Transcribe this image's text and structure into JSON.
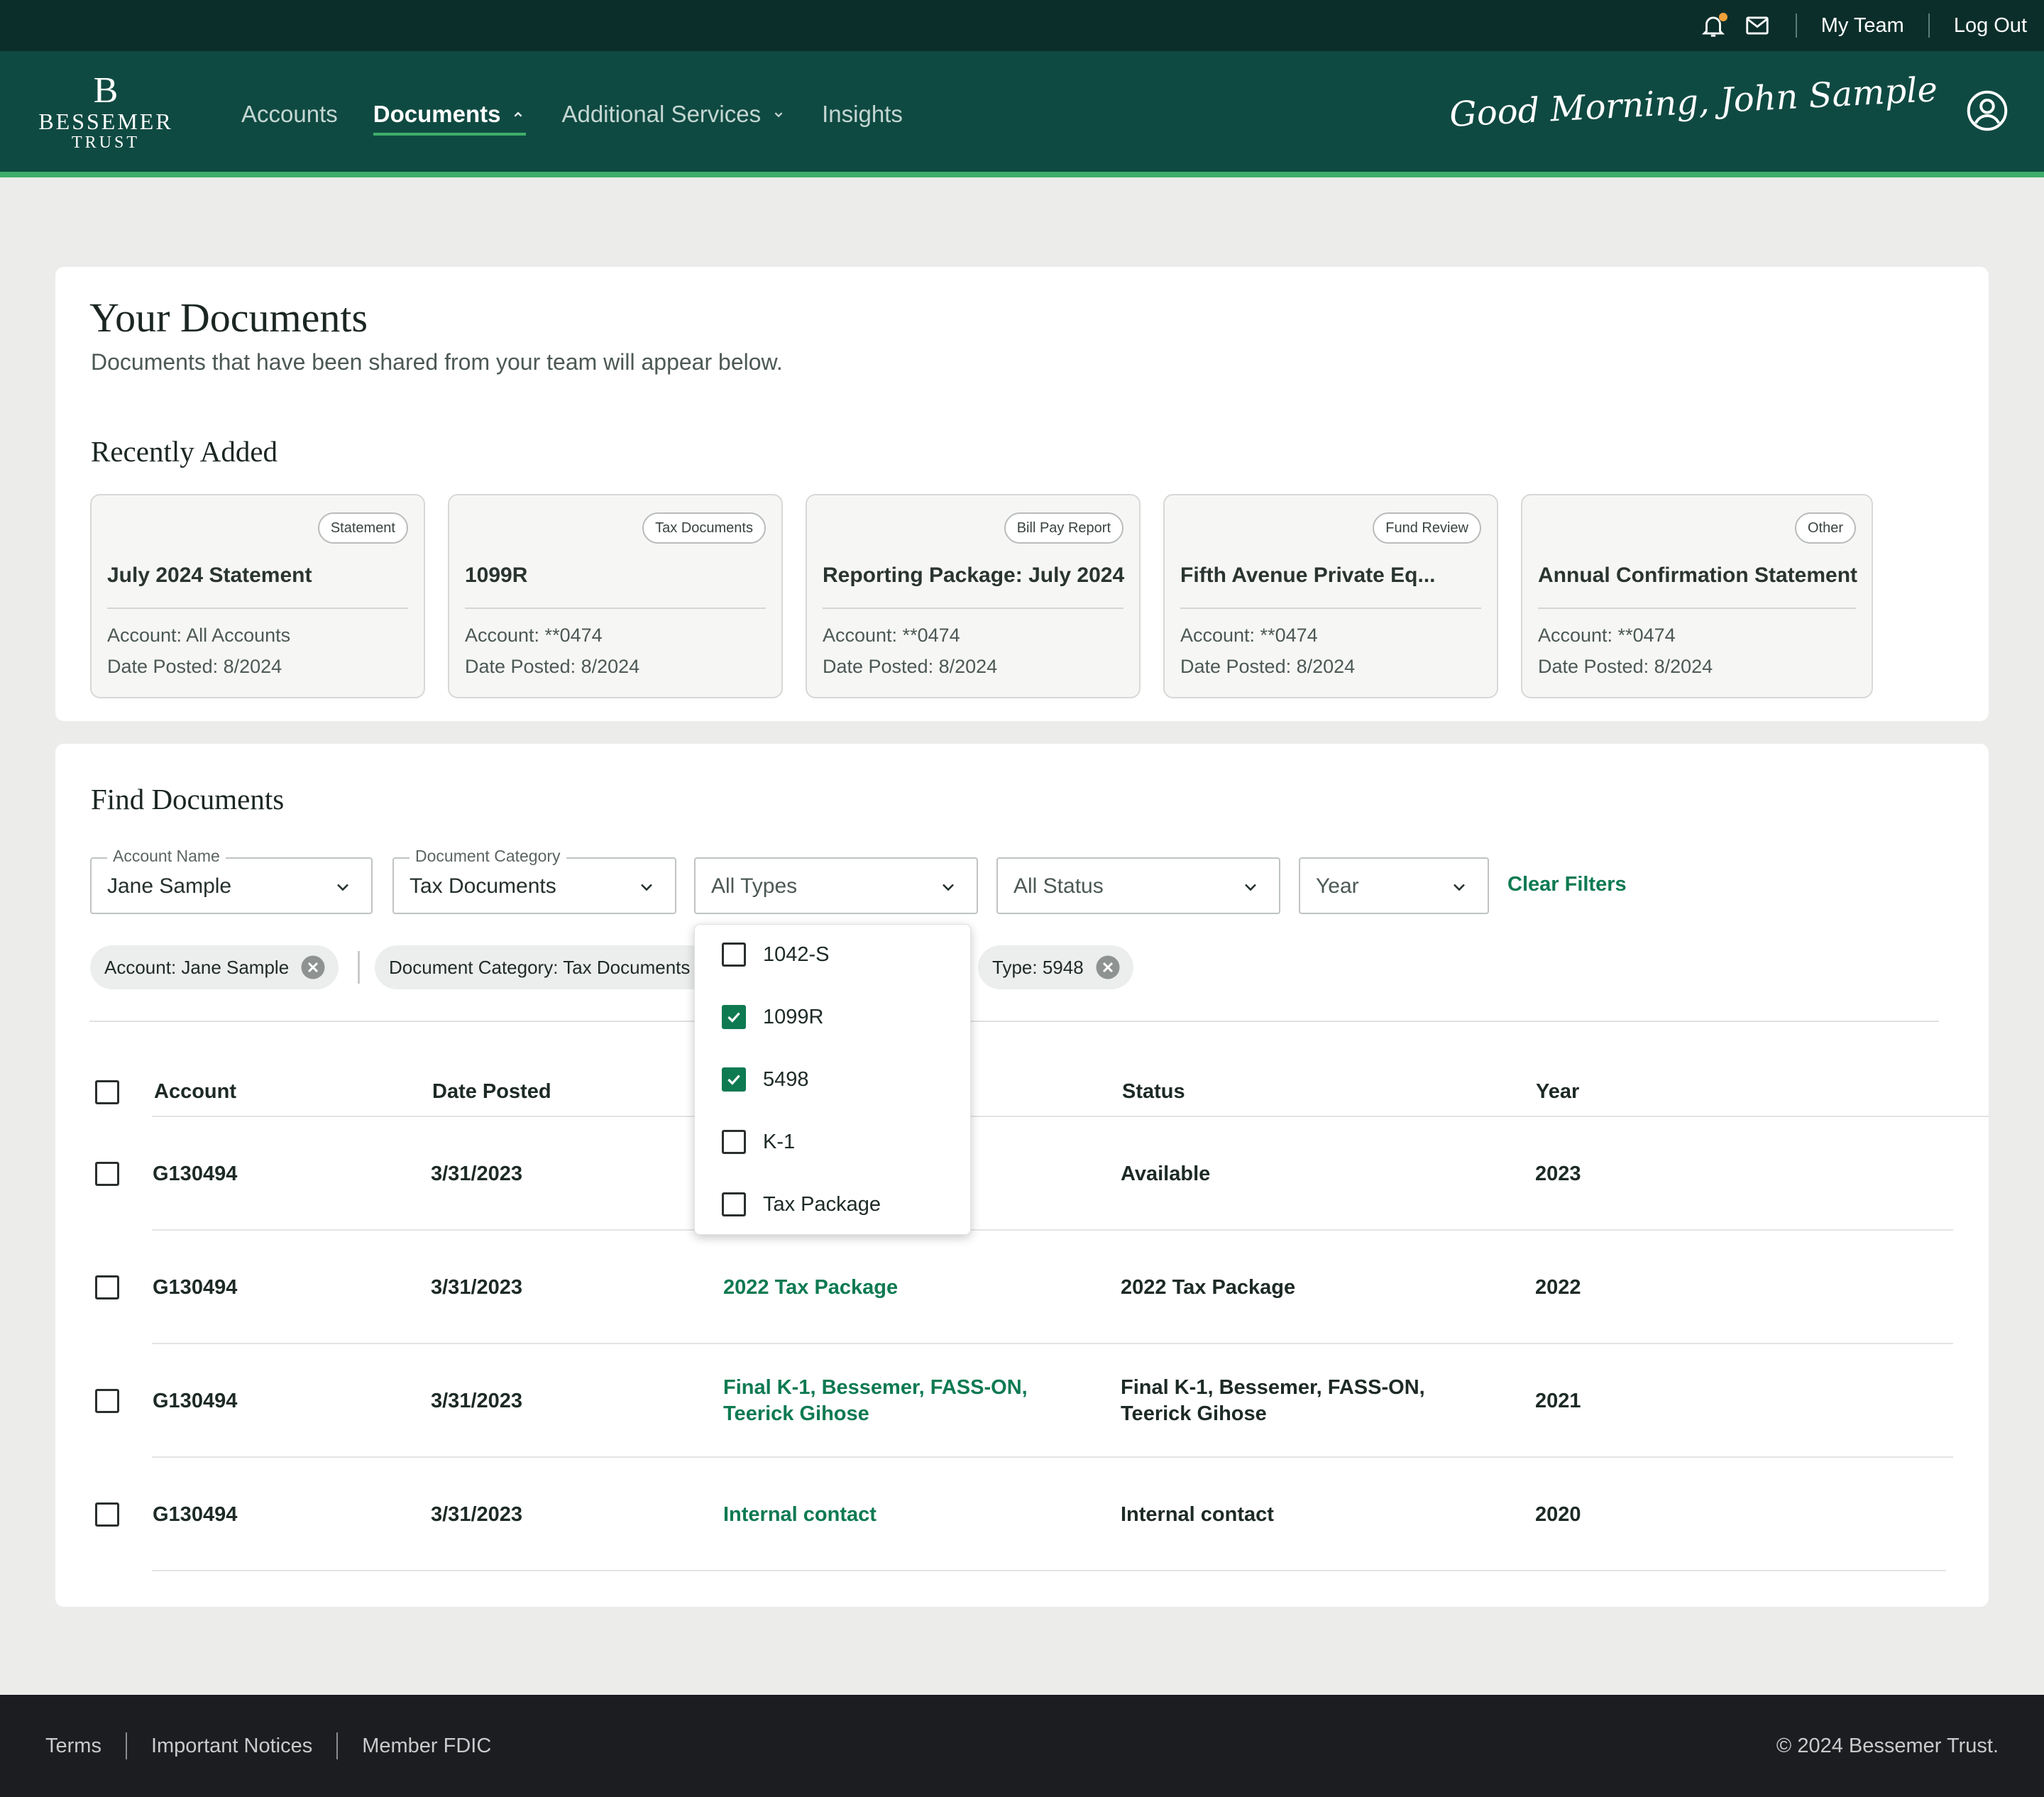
{
  "utility": {
    "my_team": "My Team",
    "log_out": "Log Out"
  },
  "brand": {
    "mark": "B",
    "name_line1": "BESSEMER",
    "name_line2": "TRUST"
  },
  "nav": {
    "items": [
      {
        "label": "Accounts"
      },
      {
        "label": "Documents"
      },
      {
        "label": "Additional Services"
      },
      {
        "label": "Insights"
      }
    ],
    "greeting": "Good Morning, John Sample"
  },
  "documents": {
    "title": "Your Documents",
    "subtitle": "Documents that have been shared from your team will appear below."
  },
  "recent": {
    "title": "Recently Added",
    "cards": [
      {
        "badge": "Statement",
        "title": "July 2024 Statement",
        "account": "Account: All Accounts",
        "date": "Date Posted: 8/2024"
      },
      {
        "badge": "Tax Documents",
        "title": "1099R",
        "account": "Account: **0474",
        "date": "Date Posted: 8/2024"
      },
      {
        "badge": "Bill Pay Report",
        "title": "Reporting Package: July 2024",
        "account": "Account: **0474",
        "date": "Date Posted: 8/2024"
      },
      {
        "badge": "Fund Review",
        "title": "Fifth Avenue Private Eq...",
        "account": "Account: **0474",
        "date": "Date Posted: 8/2024"
      },
      {
        "badge": "Other",
        "title": "Annual Confirmation Statement",
        "account": "Account: **0474",
        "date": "Date Posted: 8/2024"
      }
    ]
  },
  "find": {
    "title": "Find Documents",
    "filters": {
      "account": {
        "legend": "Account Name",
        "value": "Jane Sample"
      },
      "category": {
        "legend": "Document Category",
        "value": "Tax Documents"
      },
      "type": {
        "value": "All Types"
      },
      "status": {
        "value": "All Status"
      },
      "year": {
        "value": "Year"
      }
    },
    "clear_filters": "Clear Filters",
    "chips": [
      "Account: Jane Sample",
      "Document Category: Tax Documents",
      "Type: 5948"
    ],
    "type_options": [
      {
        "label": "1042-S",
        "checked": false
      },
      {
        "label": "1099R",
        "checked": true
      },
      {
        "label": "5498",
        "checked": true
      },
      {
        "label": "K-1",
        "checked": false
      },
      {
        "label": "Tax Package",
        "checked": false
      }
    ],
    "table": {
      "headers": [
        "Account",
        "Date Posted",
        "Status",
        "Year"
      ],
      "rows": [
        {
          "account": "G130494",
          "date": "3/31/2023",
          "document": "",
          "status": "Available",
          "year": "2023"
        },
        {
          "account": "G130494",
          "date": "3/31/2023",
          "document": "2022 Tax Package",
          "status": "2022 Tax Package",
          "year": "2022"
        },
        {
          "account": "G130494",
          "date": "3/31/2023",
          "document": "Final K-1, Bessemer, FASS-ON, Teerick Gihose",
          "status": "Final K-1, Bessemer, FASS-ON, Teerick Gihose",
          "year": "2021"
        },
        {
          "account": "G130494",
          "date": "3/31/2023",
          "document": "Internal contact",
          "status": "Internal contact",
          "year": "2020"
        }
      ]
    }
  },
  "footer": {
    "links": [
      "Terms",
      "Important Notices",
      "Member FDIC"
    ],
    "copyright": "© 2024 Bessemer Trust."
  },
  "colors": {
    "header_bg": "#0f4a42",
    "utility_bg": "#0b2e2a",
    "accent_green": "#0e7a52",
    "nav_underline": "#3fae6a",
    "notification_dot": "#f2a13a",
    "footer_bg": "#1c1d20"
  }
}
